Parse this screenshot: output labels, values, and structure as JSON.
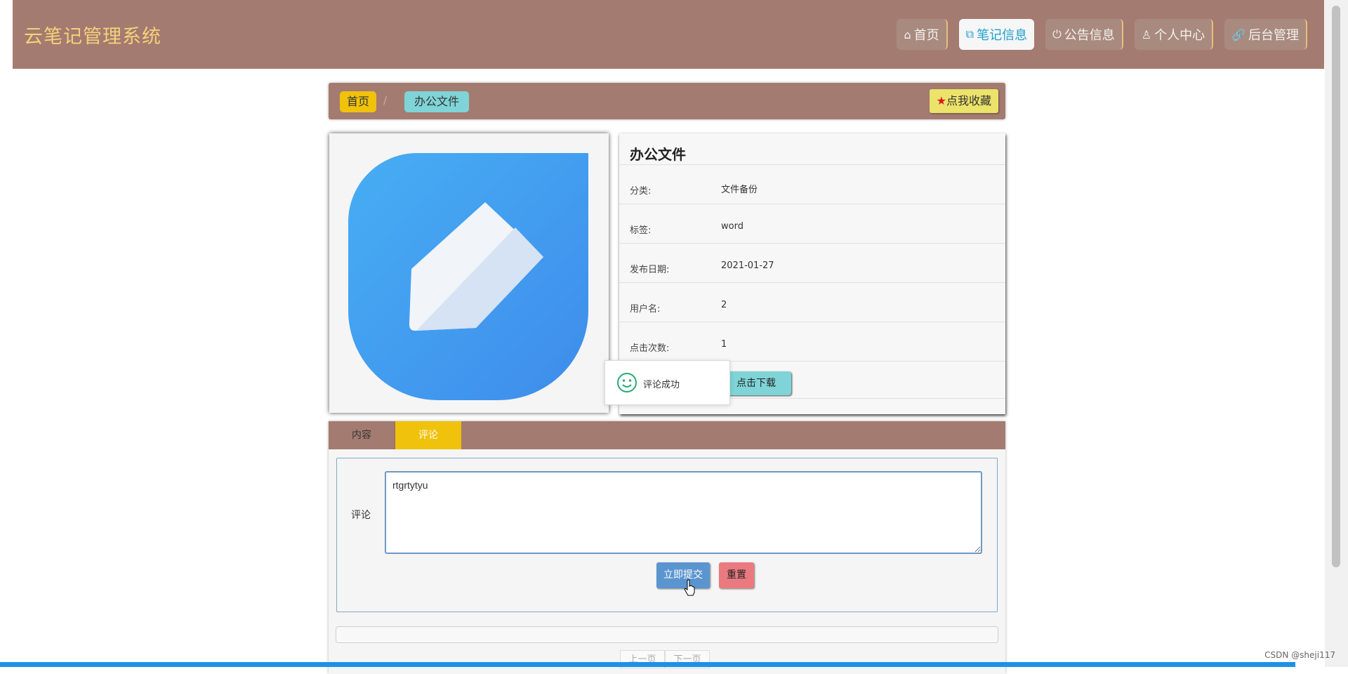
{
  "header": {
    "brand": "云笔记管理系统",
    "nav": [
      {
        "icon": "home-icon",
        "label": "首页"
      },
      {
        "icon": "notes-icon",
        "label": "笔记信息"
      },
      {
        "icon": "power-icon",
        "label": "公告信息"
      },
      {
        "icon": "user-icon",
        "label": "个人中心"
      },
      {
        "icon": "link-icon",
        "label": "后台管理"
      }
    ],
    "active_nav": "笔记信息"
  },
  "breadcrumb": {
    "home": "首页",
    "separator": "/",
    "current": "办公文件"
  },
  "favorite_button": "点我收藏",
  "detail": {
    "title": "办公文件",
    "rows": [
      {
        "label": "分类:",
        "value": "文件备份"
      },
      {
        "label": "标签:",
        "value": "word"
      },
      {
        "label": "发布日期:",
        "value": "2021-01-27"
      },
      {
        "label": "用户名:",
        "value": "2"
      },
      {
        "label": "点击次数:",
        "value": "1"
      }
    ],
    "download_button": "点击下载"
  },
  "toast": {
    "message": "评论成功"
  },
  "tabs": [
    {
      "label": "内容"
    },
    {
      "label": "评论"
    }
  ],
  "active_tab": "评论",
  "comment": {
    "label": "评论",
    "value": "rtgrtytyu",
    "submit": "立即提交",
    "reset": "重置"
  },
  "pager": {
    "prev": "上一页",
    "next": "下一页"
  },
  "watermark": "CSDN @sheji117",
  "colors": {
    "header_bg": "#a47b70",
    "brand_text": "#f2d27a",
    "active_tab": "#f0c20c",
    "crumb_current": "#7fd4d7",
    "favorite": "#ece36a",
    "submit": "#5b95cf",
    "reset": "#ea7a80"
  }
}
